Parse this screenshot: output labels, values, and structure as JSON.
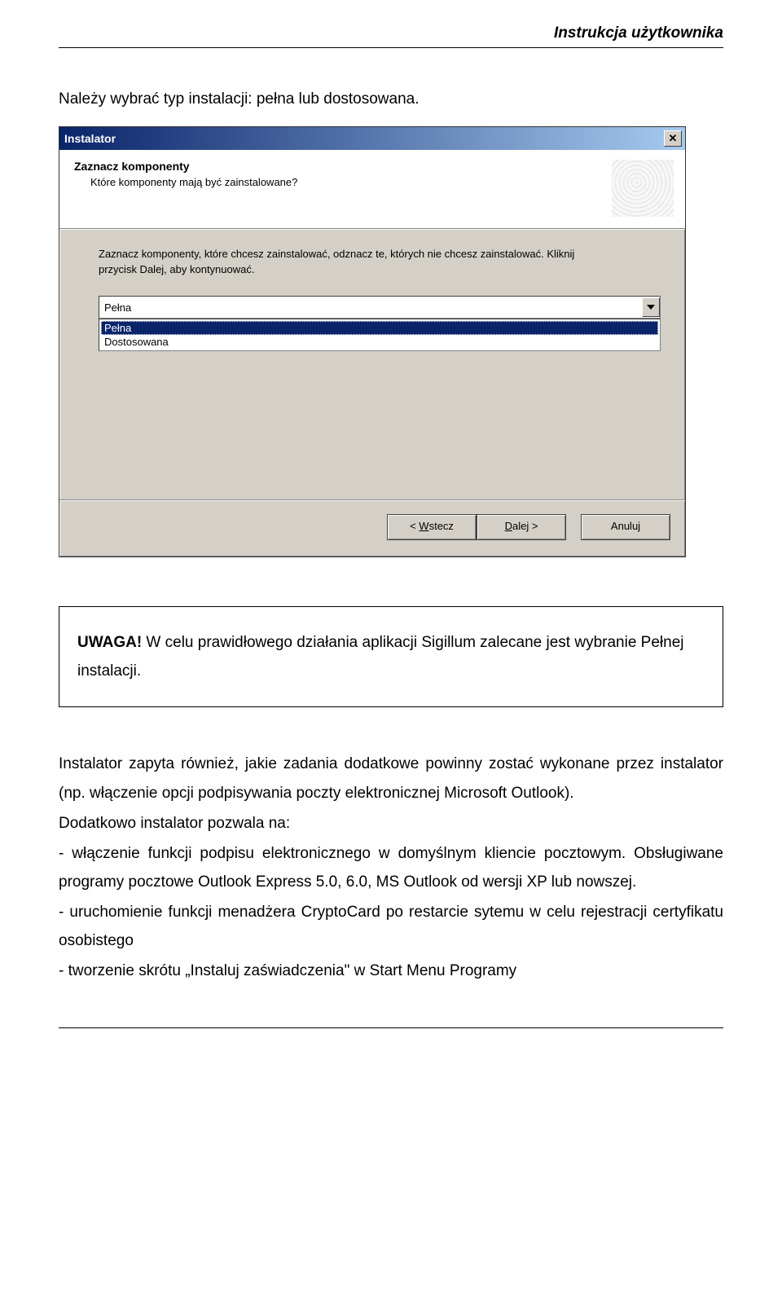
{
  "header": {
    "right": "Instrukcja użytkownika"
  },
  "intro": "Należy wybrać typ instalacji: pełna lub dostosowana.",
  "dialog": {
    "title": "Instalator",
    "close_glyph": "✕",
    "banner_title": "Zaznacz komponenty",
    "banner_sub": "Które komponenty mają być zainstalowane?",
    "instruction": "Zaznacz komponenty, które chcesz zainstalować, odznacz te, których nie chcesz zainstalować. Kliknij przycisk Dalej, aby kontynuować.",
    "combo_selected": "Pełna",
    "list_options": [
      "Pełna",
      "Dostosowana"
    ],
    "btn_back_prefix": "< ",
    "btn_back_u": "W",
    "btn_back_rest": "stecz",
    "btn_next_u": "D",
    "btn_next_rest": "alej >",
    "btn_cancel": "Anuluj"
  },
  "warning": {
    "label": "UWAGA!",
    "text": " W celu prawidłowego działania aplikacji Sigillum zalecane jest wybranie Pełnej instalacji."
  },
  "body": {
    "p1": "Instalator zapyta również, jakie zadania dodatkowe powinny zostać wykonane przez instalator (np. włączenie opcji podpisywania poczty elektronicznej Microsoft Outlook).",
    "p2": "Dodatkowo instalator pozwala na:",
    "p3": "- włączenie funkcji podpisu elektronicznego w domyślnym kliencie pocztowym. Obsługiwane programy pocztowe Outlook Express 5.0, 6.0, MS Outlook od wersji XP lub nowszej.",
    "p4": "- uruchomienie funkcji menadżera CryptoCard po restarcie sytemu w celu rejestracji certyfikatu osobistego",
    "p5": "- tworzenie skrótu „Instaluj zaświadczenia\" w Start Menu Programy"
  }
}
